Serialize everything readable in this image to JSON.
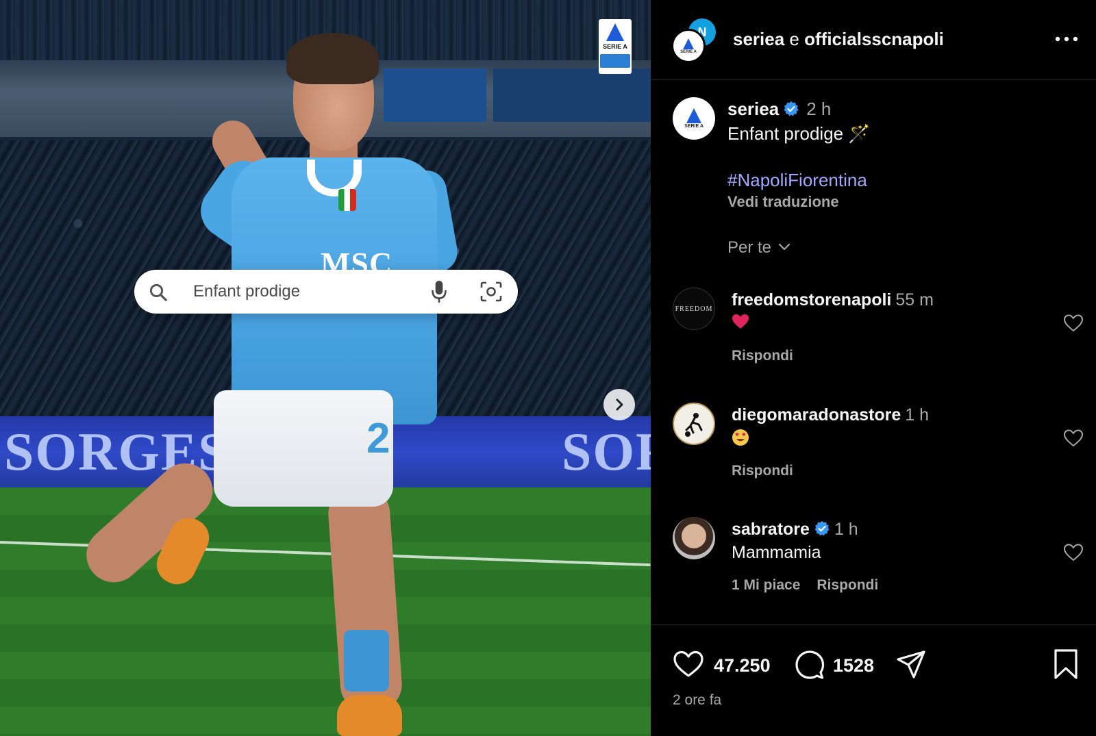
{
  "header": {
    "user1": "seriea",
    "conjunction": "e",
    "user2": "officialsscnapoli"
  },
  "media": {
    "search_text": "Enfant prodige",
    "badge_label": "SERIE A",
    "sponsor_text": "MSC",
    "shirt_number": "2",
    "adboard_left": "SORGESAN",
    "adboard_right": "SORG"
  },
  "caption": {
    "username": "seriea",
    "time": "2 h",
    "text": "Enfant prodige 🪄",
    "hashtag": "#NapoliFiorentina",
    "translate": "Vedi traduzione",
    "avatar_label": "SERIE A"
  },
  "sort": {
    "label": "Per te"
  },
  "comments": [
    {
      "username": "freedomstorenapoli",
      "time": "55 m",
      "reply": "Rispondi",
      "avatar_text": "FREEDOM",
      "emoji": "heart"
    },
    {
      "username": "diegomaradonastore",
      "time": "1 h",
      "reply": "Rispondi",
      "emoji": "heart-eyes"
    },
    {
      "username": "sabratore",
      "time": "1 h",
      "text": "Mammamia",
      "likes": "1 Mi piace",
      "reply": "Rispondi"
    }
  ],
  "footer": {
    "likes": "47.250",
    "comments": "1528",
    "ago": "2 ore fa"
  },
  "colors": {
    "background": "#000000",
    "hashtag": "#a3a8ff",
    "verified": "#3897f0",
    "muted": "#a8a8a8",
    "napoli_blue": "#12a0e0",
    "serie_a_blue": "#1e5bd6"
  },
  "icons": [
    "search-icon",
    "mic-icon",
    "lens-icon",
    "chevron-right-icon",
    "more-icon",
    "verified-icon",
    "chevron-down-icon",
    "heart-icon",
    "comment-icon",
    "share-icon",
    "bookmark-icon"
  ]
}
